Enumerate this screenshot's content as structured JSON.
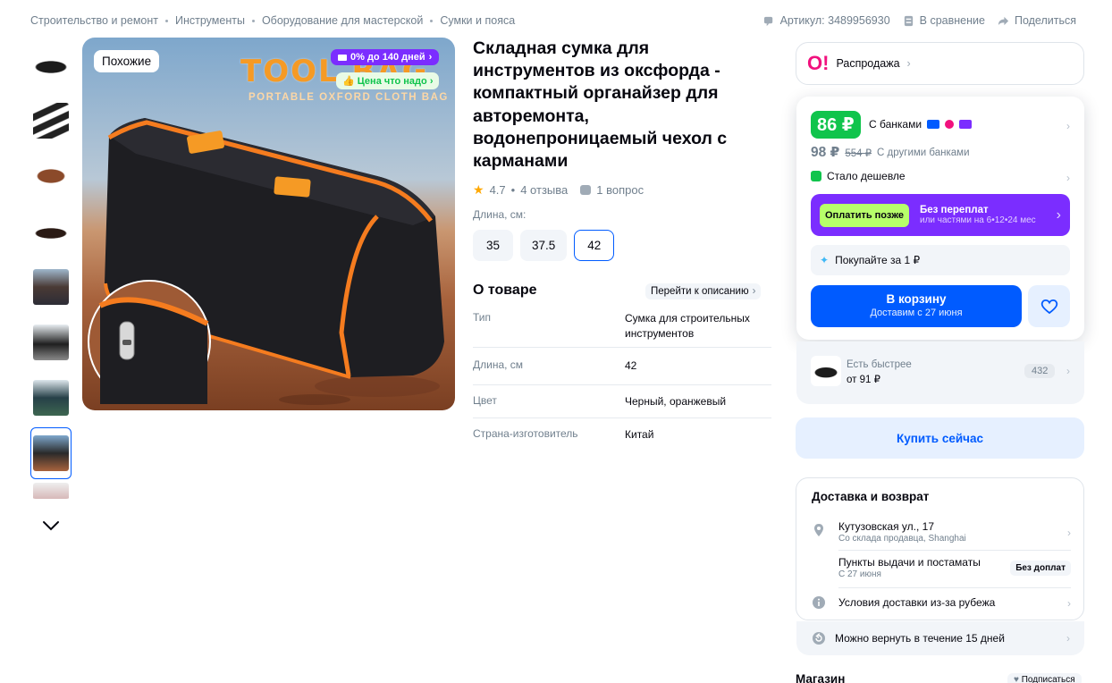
{
  "breadcrumbs": [
    "Строительство и ремонт",
    "Инструменты",
    "Оборудование для мастерской",
    "Сумки и пояса"
  ],
  "top_actions": {
    "article": "Артикул: 3489956930",
    "compare": "В сравнение",
    "share": "Поделиться"
  },
  "gallery": {
    "similar_label": "Похожие",
    "installment_label": "0% до 140 дней",
    "price_tag_label": "Цена что надо",
    "image_title": "TOOL BAG",
    "image_subtitle": "PORTABLE OXFORD CLOTH BAG"
  },
  "product": {
    "title": "Складная сумка для инструментов из оксфорда - компактный органайзер для авторемонта, водонепроницаемый чехол с карманами",
    "rating": "4.7",
    "reviews": "4 отзыва",
    "questions": "1 вопрос",
    "length_label": "Длина, см:",
    "sizes": [
      "35",
      "37.5",
      "42"
    ],
    "selected_size": "42"
  },
  "about": {
    "heading": "О товаре",
    "goto_description": "Перейти к описанию",
    "specs": [
      {
        "key": "Тип",
        "value": "Сумка для строительных инструментов"
      },
      {
        "key": "Длина, см",
        "value": "42"
      },
      {
        "key": "Цвет",
        "value": "Черный, оранжевый"
      },
      {
        "key": "Страна-изготовитель",
        "value": "Китай"
      }
    ]
  },
  "promo": {
    "logo": "O!",
    "label": "Распродажа"
  },
  "price": {
    "bank_price": "86 ₽",
    "with_banks": "С банками",
    "other_price": "98 ₽",
    "old_price": "554 ₽",
    "other_banks": "С другими банками",
    "cheaper": "Стало дешевле",
    "pay_later_button": "Оплатить позже",
    "pay_later_title": "Без переплат",
    "pay_later_sub": "или частями на 6•12•24 мес",
    "buy_for_ruble": "Покупайте за 1 ₽",
    "cart_title": "В корзину",
    "cart_sub": "Доставим с 27 июня"
  },
  "faster": {
    "label": "Есть быстрее",
    "price": "от 91 ₽",
    "count": "432"
  },
  "buy_now": "Купить сейчас",
  "delivery": {
    "heading": "Доставка и возврат",
    "address": "Кутузовская ул., 17",
    "address_sub": "Со склада продавца, Shanghai",
    "pickup": "Пункты выдачи и постаматы",
    "pickup_sub": "С 27 июня",
    "pickup_badge": "Без доплат",
    "abroad": "Условия доставки из-за рубежа",
    "returns": "Можно вернуть в течение 15 дней"
  },
  "shop": {
    "heading": "Магазин",
    "subscribe": "Подписаться"
  },
  "colors": {
    "accent": "#005bff",
    "green": "#10c44c",
    "purple": "#7b2dff",
    "bag_orange": "#f57c1f"
  }
}
